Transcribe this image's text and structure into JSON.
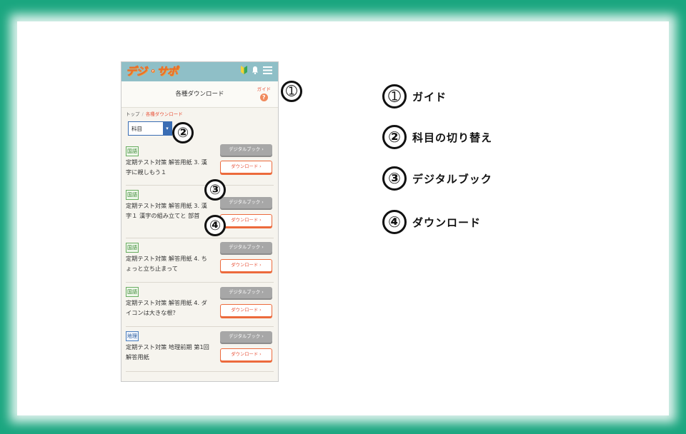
{
  "app": {
    "logo": "デジ・サポ",
    "page_title": "各種ダウンロード",
    "guide_label": "ガイド",
    "guide_icon": "?",
    "breadcrumb": {
      "home": "トップ",
      "separator": "/",
      "current": "各種ダウンロード"
    },
    "subject_select": {
      "value": "科目",
      "arrow": "▾"
    }
  },
  "items": [
    {
      "subject": "国語",
      "title": "定期テスト対策 解答用紙 3. 漢字に親しもう１",
      "digital": "デジタルブック ›",
      "download": "ダウンロード ›"
    },
    {
      "subject": "国語",
      "title": "定期テスト対策 解答用紙 3. 漢字１ 漢字の組み立てと 部首",
      "digital": "デジタルブック ›",
      "download": "ダウンロード ›"
    },
    {
      "subject": "国語",
      "title": "定期テスト対策 解答用紙 4. ちょっと立ち止まって",
      "digital": "デジタルブック ›",
      "download": "ダウンロード ›"
    },
    {
      "subject": "国語",
      "title": "定期テスト対策 解答用紙 4. ダイコンは大きな根？",
      "digital": "デジタルブック ›",
      "download": "ダウンロード ›"
    },
    {
      "subject": "地理",
      "title": "定期テスト対策 地理前期 第1回 解答用紙",
      "digital": "デジタルブック ›",
      "download": "ダウンロード ›"
    }
  ],
  "callouts": {
    "n1": "➀",
    "n2": "②",
    "n3": "③",
    "n4": "④"
  },
  "legend": [
    {
      "num": "➀",
      "label": "ガイド"
    },
    {
      "num": "②",
      "label": "科目の切り替え"
    },
    {
      "num": "③",
      "label": "デジタルブック"
    },
    {
      "num": "④",
      "label": "ダウンロード"
    }
  ],
  "colors": {
    "frame": "#1aa67f",
    "header": "#8fbfc7",
    "accent": "#e8533a",
    "select": "#3a6db4"
  }
}
